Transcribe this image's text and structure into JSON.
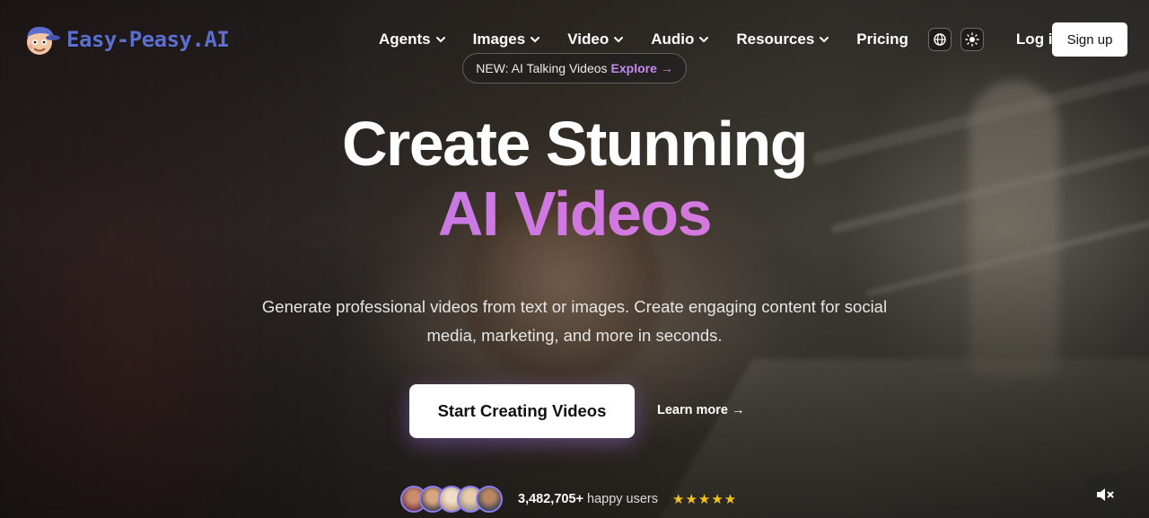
{
  "brand": {
    "name": "Easy-Peasy.AI",
    "color": "#5c6fcf"
  },
  "nav": {
    "items": [
      {
        "label": "Agents",
        "dropdown": true
      },
      {
        "label": "Images",
        "dropdown": true
      },
      {
        "label": "Video",
        "dropdown": true
      },
      {
        "label": "Audio",
        "dropdown": true
      },
      {
        "label": "Resources",
        "dropdown": true
      },
      {
        "label": "Pricing",
        "dropdown": false
      }
    ],
    "icons": [
      "globe-icon",
      "sun-icon"
    ],
    "login": "Log in",
    "signup": "Sign up"
  },
  "announcement": {
    "text": "NEW: AI Talking Videos",
    "link": "Explore",
    "arrow": "→",
    "link_color": "#c389f0"
  },
  "hero": {
    "title_line1": "Create Stunning",
    "title_line2": "AI Videos",
    "gradient_colors": [
      "#b07ee8",
      "#e07bd8"
    ],
    "subtitle": "Generate professional videos from text or images. Create engaging content for social media, marketing, and more in seconds.",
    "cta": "Start Creating Videos",
    "learn_more": "Learn more →"
  },
  "social_proof": {
    "count": "3,482,705+",
    "label": "happy users",
    "stars": "★★★★★",
    "rating": 5,
    "avatar_count": 5
  },
  "media_controls": {
    "mute": "mute-icon"
  }
}
